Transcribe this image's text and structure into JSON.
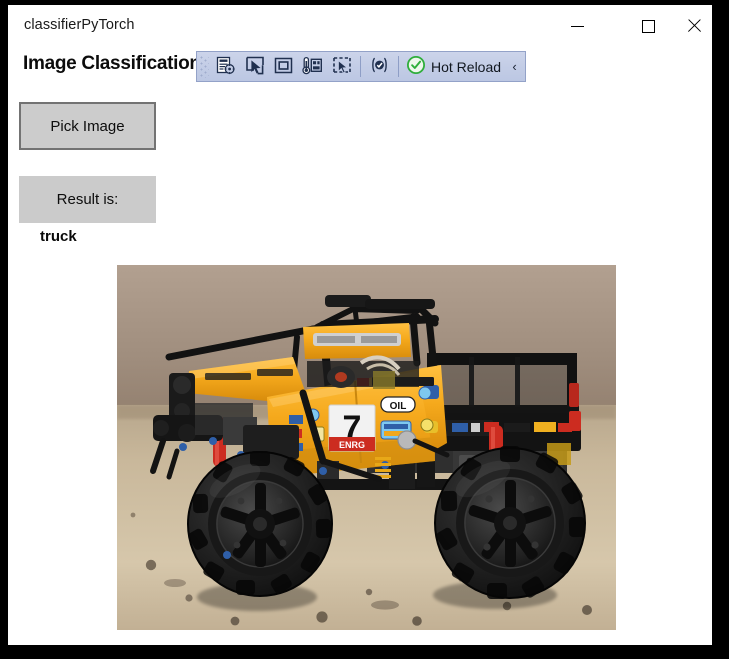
{
  "window": {
    "title": "classifierPyTorch",
    "controls": {
      "minimize": "minimize-icon",
      "maximize": "maximize-icon",
      "close": "close-icon"
    }
  },
  "page": {
    "heading": "Image Classification"
  },
  "toolbar": {
    "name": "xaml-hot-reload-toolbar",
    "grip": "drag-grip",
    "buttons": [
      {
        "name": "go-to-live-visual-tree",
        "icon": "document-target-icon",
        "tooltip": "Go to Live Visual Tree"
      },
      {
        "name": "select-element",
        "icon": "cursor-select-icon",
        "tooltip": "Select Element"
      },
      {
        "name": "display-layout-adorners",
        "icon": "square-outline-icon",
        "tooltip": "Display Layout Adorners"
      },
      {
        "name": "track-focused-element",
        "icon": "thermometer-panel-icon",
        "tooltip": "Track Focused Element"
      },
      {
        "name": "preview-selection",
        "icon": "dashed-select-icon",
        "tooltip": "Preview Selection"
      },
      {
        "name": "disable-hot-reload-on-save",
        "icon": "slashed-circle-icon",
        "tooltip": "Hot Reload on File Save"
      }
    ],
    "hot_reload": {
      "label": "Hot Reload",
      "status_icon": "green-check-circle-icon",
      "status_color": "#2eae3b"
    },
    "overflow": "‹",
    "background": "#c3cde6",
    "border": "#93a2c8"
  },
  "controls": {
    "pick_image_label": "Pick Image",
    "result_label": "Result is:",
    "result_value": "truck",
    "button_face": "#cccccc",
    "button_border": "#737373"
  },
  "photo": {
    "name": "classified-image",
    "alt": "Yellow LEGO Technic 4x4 X-treme Off-Roader monster truck on a granite countertop",
    "subject_number": "7",
    "colors": {
      "wall": "#a89484",
      "counter": "#cdbda4",
      "body_yellow": "#f4a81e",
      "body_yellow_dark": "#cf8a12",
      "tire_black": "#1a1a1a",
      "accent_red": "#cc2c20",
      "accent_blue": "#2f5fa8"
    }
  }
}
